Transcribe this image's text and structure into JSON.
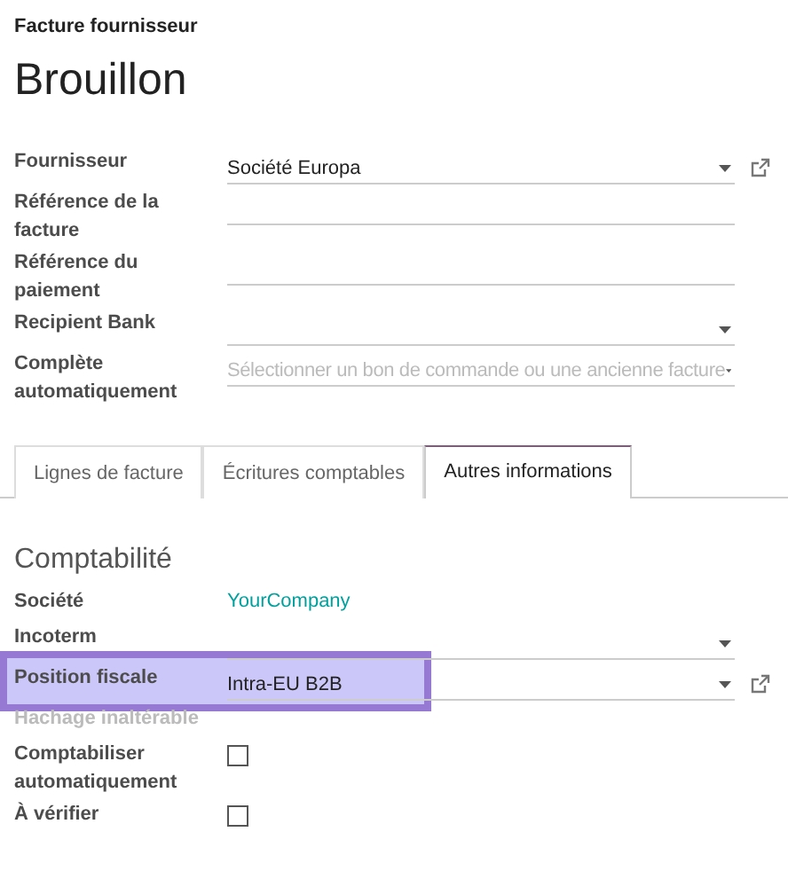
{
  "header": {
    "subtitle": "Facture fournisseur",
    "title": "Brouillon"
  },
  "fields": [
    {
      "label": "Fournisseur",
      "kind": "select",
      "value": "Société Europa",
      "external_link": true
    },
    {
      "label": "Référence de la facture",
      "kind": "text"
    },
    {
      "label": "Référence du paiement",
      "kind": "text"
    },
    {
      "label": "Recipient Bank",
      "kind": "select"
    },
    {
      "label": "Complète automatiquement",
      "kind": "select",
      "placeholder": "Sélectionner un bon de commande ou une ancienne facture"
    }
  ],
  "tabs": [
    {
      "label": "Lignes de facture",
      "selected": false
    },
    {
      "label": "Écritures comptables",
      "selected": false
    },
    {
      "label": "Autres informations",
      "selected": true
    }
  ],
  "section": {
    "title": "Comptabilité",
    "fields": [
      {
        "label": "Société",
        "kind": "link",
        "value": "YourCompany"
      },
      {
        "label": "Incoterm",
        "kind": "select"
      },
      {
        "label": "Position fiscale",
        "kind": "select",
        "value": "Intra-EU B2B",
        "external_link": true,
        "highlighted": true
      },
      {
        "label": "Hachage inaltérable",
        "kind": "disabled"
      },
      {
        "label": "Comptabiliser automatiquement",
        "kind": "checkbox",
        "checked": false
      },
      {
        "label": "À vérifier",
        "kind": "checkbox",
        "checked": false
      }
    ]
  }
}
